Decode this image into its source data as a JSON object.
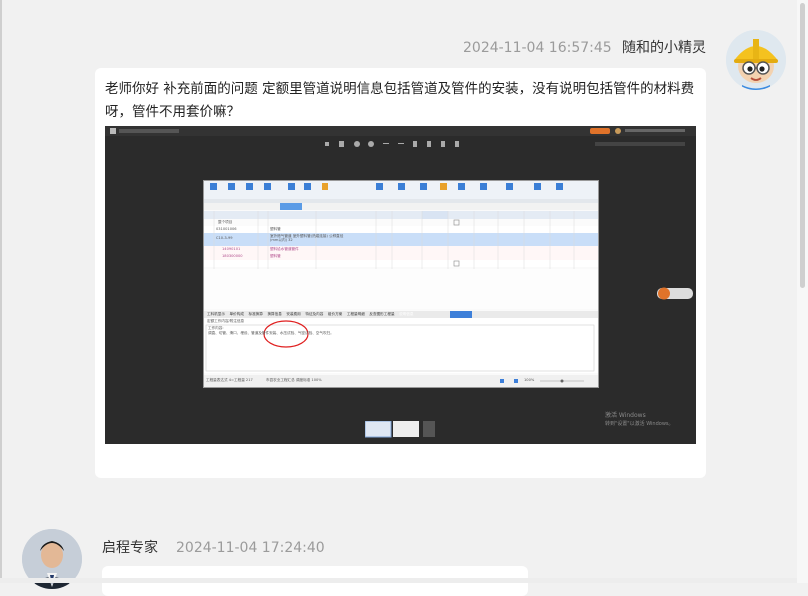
{
  "message1": {
    "timestamp": "2024-11-04 16:57:45",
    "sender": "随和的小精灵",
    "text": "老师你好 补充前面的问题 定额里管道说明信息包括管道及管件的安装，没有说明包括管件的材料费呀，管件不用套价嘛？"
  },
  "message2": {
    "sender": "启程专家",
    "timestamp": "2024-11-04 17:24:40"
  },
  "screenshot": {
    "software_tabs": [
      "工料机显示",
      "单价构成",
      "标准换算",
      "换算信息",
      "安装费用",
      "特征及内容",
      "组价方案",
      "工程量明细",
      "反查图形工程量",
      "说明信息"
    ],
    "active_tab": "说明信息",
    "content_heading": "定额工作内容/附注信息",
    "content_sub": "工作内容:",
    "content_text": "调直、切管、滑口、埋设、管道及管件安装、水压试验、气密试验、空气吹扫。",
    "table_rows": [
      {
        "code": "整个项目",
        "name": ""
      },
      {
        "code": "031001006",
        "name": "塑料管"
      },
      {
        "code": "C10-3-99",
        "name": "室外燃气管道 室外塑料管(热熔连接) 公称直径(mm以内) 32"
      },
      {
        "code": "14090101",
        "name": "塑料给水管道管件"
      },
      {
        "code": "180300000",
        "name": "塑料管"
      }
    ],
    "status_left": "工程量表达式 4=工程量 217",
    "status_mid": "市县农业工程汇总 调度标准 100%",
    "status_right": "100%",
    "watermark_line1": "激活 Windows",
    "watermark_line2": "转到\"设置\"以激活 Windows。"
  },
  "colors": {
    "page_bg": "#f1f1f1",
    "bubble_bg": "#ffffff",
    "meta_text": "#9b9b9b",
    "sender_text": "#333333",
    "screenshot_bg": "#2b2b2b",
    "active_tab": "#3d7fd9",
    "selected_row": "#c9def8",
    "annotation": "#e02020"
  },
  "icons": [
    "avatar-cartoon-hardhat",
    "avatar-expert-photo"
  ]
}
